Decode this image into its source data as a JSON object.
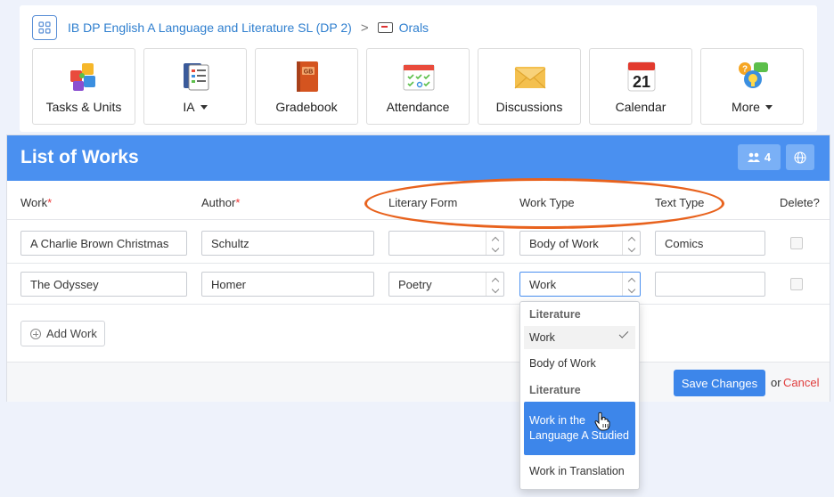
{
  "breadcrumb": {
    "course": "IB DP English A Language and Literature SL (DP 2)",
    "separator": ">",
    "current": "Orals"
  },
  "nav_tiles": [
    {
      "label": "Tasks & Units",
      "icon": "puzzle-icon",
      "has_caret": false
    },
    {
      "label": "IA",
      "icon": "clipboard-icon",
      "has_caret": true
    },
    {
      "label": "Gradebook",
      "icon": "gradebook-icon",
      "has_caret": false
    },
    {
      "label": "Attendance",
      "icon": "attendance-icon",
      "has_caret": false
    },
    {
      "label": "Discussions",
      "icon": "envelope-icon",
      "has_caret": false
    },
    {
      "label": "Calendar",
      "icon": "calendar-icon",
      "has_caret": false
    },
    {
      "label": "More",
      "icon": "chat-bubbles-icon",
      "has_caret": true
    }
  ],
  "calendar_day": "21",
  "gradebook_badge": "GB",
  "panel": {
    "title": "List of Works",
    "members_count": "4"
  },
  "columns": {
    "work": "Work",
    "author": "Author",
    "required_mark": "*",
    "literary_form": "Literary Form",
    "work_type": "Work Type",
    "text_type": "Text Type",
    "delete": "Delete?"
  },
  "rows": [
    {
      "work": "A Charlie Brown Christmas",
      "author": "Schultz",
      "literary_form": "",
      "work_type": "Body of Work",
      "text_type": "Comics",
      "delete": false
    },
    {
      "work": "The Odyssey",
      "author": "Homer",
      "literary_form": "Poetry",
      "work_type": "Work",
      "text_type": "",
      "delete": false
    }
  ],
  "add_work_label": "Add Work",
  "footer": {
    "save_label": "Save Changes",
    "or_text": "or",
    "cancel_label": "Cancel"
  },
  "work_type_dropdown": {
    "groups": [
      {
        "label": "Literature",
        "options": [
          {
            "label": "Work",
            "selected": true
          },
          {
            "label": "Body of Work",
            "selected": false
          }
        ]
      },
      {
        "label": "Literature",
        "options": [
          {
            "label": "Work in the Language A Studied",
            "highlighted": true
          },
          {
            "label": "Work in Translation",
            "highlighted": false
          }
        ]
      }
    ]
  },
  "colors": {
    "header_blue": "#4a90f0",
    "link_blue": "#2f7fcf",
    "annotation_orange": "#e8621d",
    "cancel_red": "#e03c3c"
  }
}
